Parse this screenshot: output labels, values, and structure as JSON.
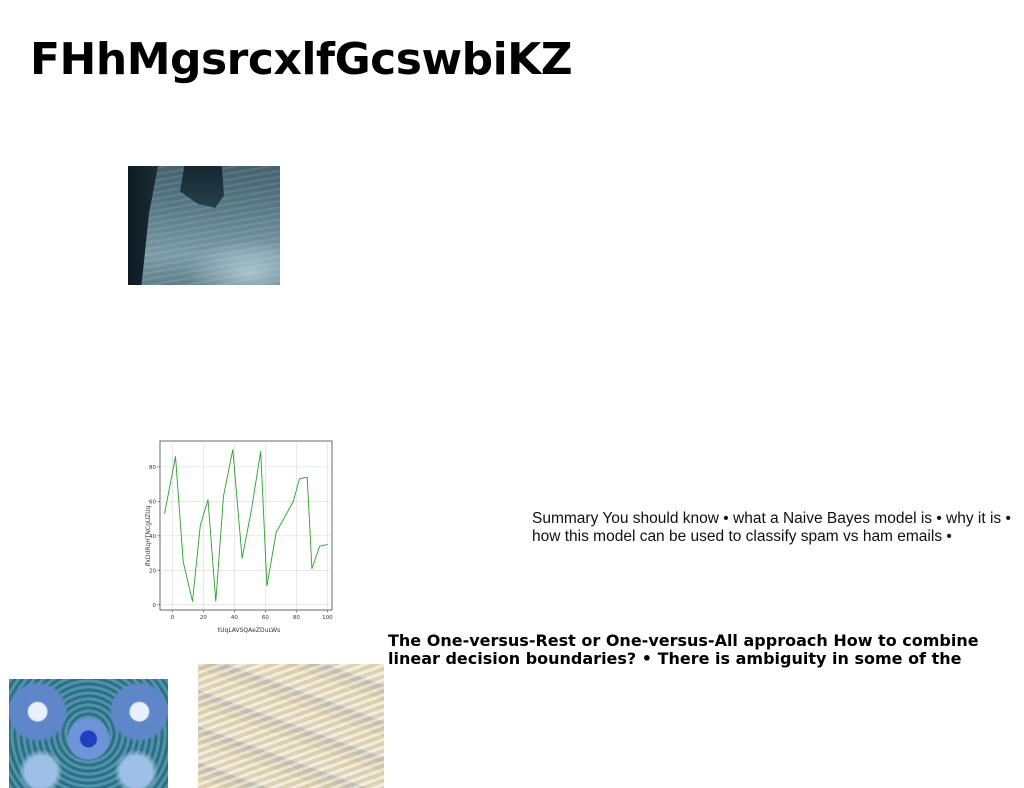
{
  "page": {
    "title": "FHhMgsrcxlfGcswbiKZ",
    "summary_text": "Summary You should know • what a Naive Bayes model is • why it is • how this model can be used to classify spam vs ham emails •",
    "approach_text": "The One-versus-Rest or One-versus-All approach How to combine linear decision boundaries? • There is ambiguity in some of the"
  },
  "images": {
    "sea_cliff": "sea-cliff-photo",
    "blue_floral": "blue-floral-pattern-photo",
    "wavy_pastel": "pastel-wave-pattern-photo"
  },
  "chart_data": {
    "type": "line",
    "xlabel": "tUqLAVSQAeZDuLWs",
    "ylabel": "ifxDdRqHTNCgUZUq",
    "x": [
      -5,
      2,
      7,
      13,
      18,
      23,
      28,
      33,
      39,
      45,
      51,
      57,
      61,
      67,
      78,
      82,
      87,
      90,
      95,
      100
    ],
    "values": [
      53,
      86,
      25,
      2,
      46,
      61,
      2,
      63,
      90,
      27,
      55,
      89,
      11,
      42,
      60,
      73,
      74,
      21,
      34,
      35
    ],
    "xticks": [
      "0",
      "20",
      "40",
      "60",
      "80",
      "100"
    ],
    "yticks": [
      "0",
      "20",
      "40",
      "60",
      "80"
    ],
    "xlim": [
      -8,
      103
    ],
    "ylim": [
      -3,
      95
    ],
    "grid": true,
    "line_color": "#2ca02c"
  }
}
